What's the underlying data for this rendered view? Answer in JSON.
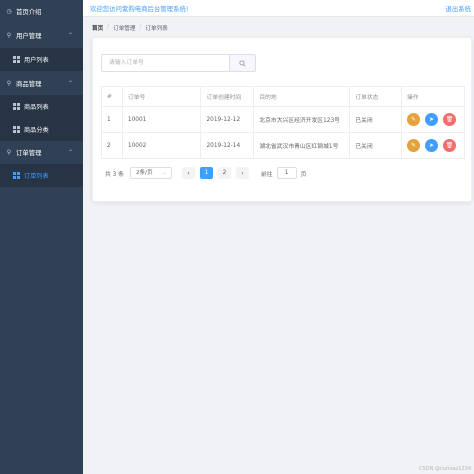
{
  "sidebar": {
    "background": "#304156",
    "active_color": "#409eff",
    "items": [
      {
        "label": "首页介绍",
        "icon": "dashboard-icon"
      },
      {
        "label": "用户管理",
        "icon": "location-icon",
        "children": [
          {
            "label": "用户列表",
            "icon": "grid-icon"
          }
        ]
      },
      {
        "label": "商品管理",
        "icon": "location-icon",
        "children": [
          {
            "label": "商品列表",
            "icon": "grid-icon"
          },
          {
            "label": "商品分类",
            "icon": "grid-icon"
          }
        ]
      },
      {
        "label": "订单管理",
        "icon": "location-icon",
        "children": [
          {
            "label": "订单列表",
            "icon": "grid-icon",
            "active": true
          }
        ]
      }
    ]
  },
  "header": {
    "welcome": "欢迎您访问紫购电商后台管理系统!",
    "logout": "退出系统"
  },
  "breadcrumb": [
    "首页",
    "订单管理",
    "订单列表"
  ],
  "search": {
    "placeholder": "请输入订单号",
    "value": ""
  },
  "table": {
    "columns": [
      "#",
      "订单号",
      "订单创建时间",
      "目的地",
      "订单状态",
      "操作"
    ],
    "rows": [
      {
        "index": "1",
        "order_no": "10001",
        "created": "2019-12-12",
        "destination": "北京市大兴区经济开发区123号",
        "status": "已关闭"
      },
      {
        "index": "2",
        "order_no": "10002",
        "created": "2019-12-14",
        "destination": "湖北省武汉市青山区红钢城1号",
        "status": "已关闭"
      }
    ],
    "actions": [
      "edit-icon",
      "location-icon",
      "delete-icon"
    ]
  },
  "pagination": {
    "total": "共 3 条",
    "page_size": "2条/页",
    "prev": "‹",
    "next": "›",
    "pages": [
      "1",
      "2"
    ],
    "current_page": "1",
    "goto_label": "前往",
    "goto_value": "1",
    "goto_suffix": "页"
  },
  "watermark": "CSDN @cumiao1234"
}
